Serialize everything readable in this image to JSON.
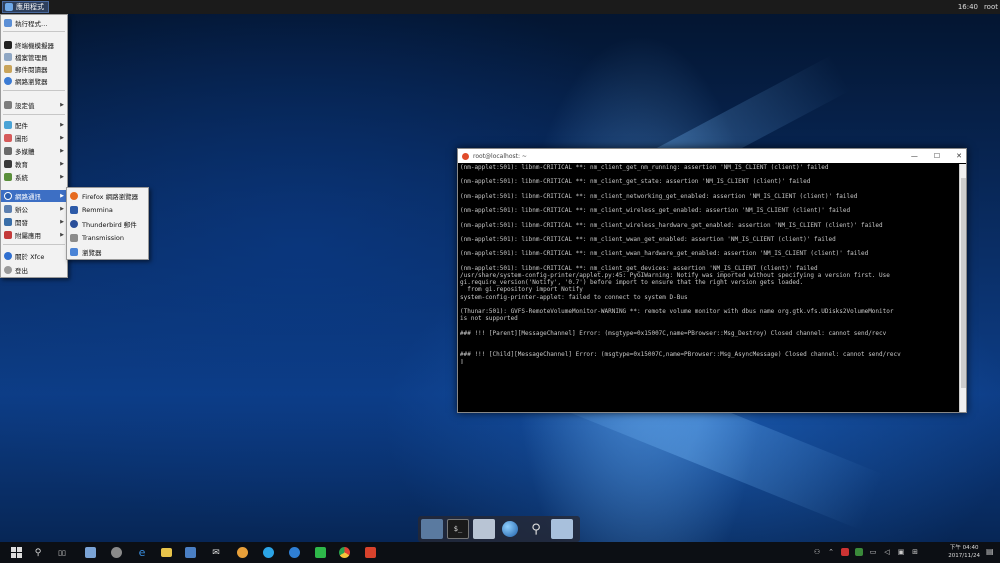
{
  "top_panel": {
    "apps_button_label": "應用程式",
    "clock": "16:40",
    "user": "root"
  },
  "apps_menu": {
    "items": [
      {
        "label": "執行程式…",
        "submenu": false
      },
      {
        "label": "終端機模擬器",
        "submenu": false
      },
      {
        "label": "檔案管理員",
        "submenu": false
      },
      {
        "label": "郵件閱讀器",
        "submenu": false
      },
      {
        "label": "網路瀏覽器",
        "submenu": false
      },
      {
        "label": "設定值",
        "submenu": true
      },
      {
        "label": "配件",
        "submenu": true
      },
      {
        "label": "圖形",
        "submenu": true
      },
      {
        "label": "多媒體",
        "submenu": true
      },
      {
        "label": "教育",
        "submenu": true
      },
      {
        "label": "系統",
        "submenu": true
      },
      {
        "label": "網路通訊",
        "submenu": true
      },
      {
        "label": "辦公",
        "submenu": true
      },
      {
        "label": "開發",
        "submenu": true
      },
      {
        "label": "附屬應用",
        "submenu": true
      },
      {
        "label": "關於 Xfce",
        "submenu": false
      },
      {
        "label": "登出",
        "submenu": false
      }
    ]
  },
  "internet_submenu": {
    "items": [
      {
        "label": "Firefox 網路瀏覽器"
      },
      {
        "label": "Remmina"
      },
      {
        "label": "Thunderbird 郵件"
      },
      {
        "label": "Transmission"
      },
      {
        "label": "瀏覽器"
      }
    ]
  },
  "terminal": {
    "title": "root@localhost: ~",
    "lines": [
      "(nm-applet:501): libnm-CRITICAL **: nm_client_get_nm_running: assertion 'NM_IS_CLIENT (client)' failed",
      "",
      "(nm-applet:501): libnm-CRITICAL **: nm_client_get_state: assertion 'NM_IS_CLIENT (client)' failed",
      "",
      "(nm-applet:501): libnm-CRITICAL **: nm_client_networking_get_enabled: assertion 'NM_IS_CLIENT (client)' failed",
      "",
      "(nm-applet:501): libnm-CRITICAL **: nm_client_wireless_get_enabled: assertion 'NM_IS_CLIENT (client)' failed",
      "",
      "(nm-applet:501): libnm-CRITICAL **: nm_client_wireless_hardware_get_enabled: assertion 'NM_IS_CLIENT (client)' failed",
      "",
      "(nm-applet:501): libnm-CRITICAL **: nm_client_wwan_get_enabled: assertion 'NM_IS_CLIENT (client)' failed",
      "",
      "(nm-applet:501): libnm-CRITICAL **: nm_client_wwan_hardware_get_enabled: assertion 'NM_IS_CLIENT (client)' failed",
      "",
      "(nm-applet:501): libnm-CRITICAL **: nm_client_get_devices: assertion 'NM_IS_CLIENT (client)' failed",
      "/usr/share/system-config-printer/applet.py:45: PyGIWarning: Notify was imported without specifying a version first. Use",
      "gi.require_version('Notify', '0.7') before import to ensure that the right version gets loaded.",
      "  from gi.repository import Notify",
      "system-config-printer-applet: failed to connect to system D-Bus",
      "",
      "(Thunar:501): GVFS-RemoteVolumeMonitor-WARNING **: remote volume monitor with dbus name org.gtk.vfs.UDisks2VolumeMonitor",
      "is not supported",
      "",
      "### !!! [Parent][MessageChannel] Error: (msgtype=0x15007C,name=PBrowser::Msg_Destroy) Closed channel: cannot send/recv",
      "",
      "",
      "### !!! [Child][MessageChannel] Error: (msgtype=0x15007C,name=PBrowser::Msg_AsyncMessage) Closed channel: cannot send/recv",
      "▯"
    ]
  },
  "taskbar": {
    "clock_time": "下午 04:40",
    "clock_date": "2017/11/24"
  },
  "colors": {
    "menu_highlight": "#3d6fc4",
    "terminal_bg": "#000000",
    "taskbar_bg": "#0c0f14"
  }
}
